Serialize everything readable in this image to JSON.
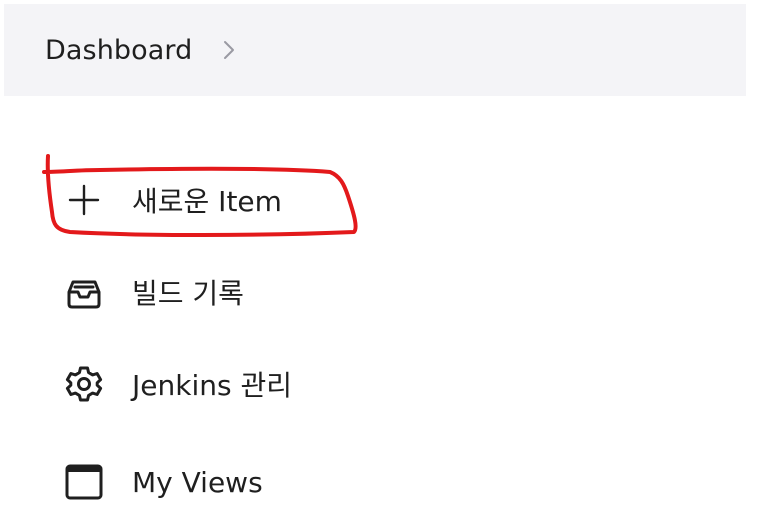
{
  "breadcrumb": {
    "items": [
      {
        "label": "Dashboard"
      }
    ]
  },
  "sidebar": {
    "items": [
      {
        "label": "새로운 Item",
        "icon": "plus-icon"
      },
      {
        "label": "빌드 기록",
        "icon": "inbox-icon"
      },
      {
        "label": "Jenkins 관리",
        "icon": "gear-icon"
      },
      {
        "label": "My Views",
        "icon": "window-icon"
      }
    ]
  },
  "annotation": {
    "color": "#e3191b"
  }
}
